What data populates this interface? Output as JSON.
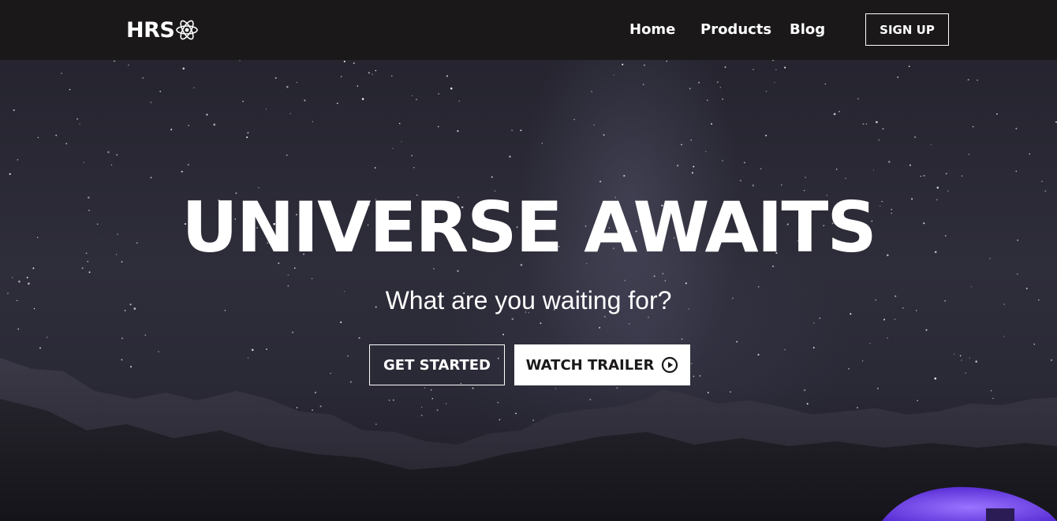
{
  "nav": {
    "logo_text": "HRS",
    "logo_icon": "atom-icon",
    "links": [
      "Home",
      "Products",
      "Blog"
    ],
    "signup_label": "SIGN UP"
  },
  "hero": {
    "title": "UNIVERSE AWAITS",
    "subtitle": "What are you waiting for?",
    "primary_button": "GET STARTED",
    "secondary_button": "WATCH TRAILER",
    "secondary_icon": "play-circle-icon"
  },
  "colors": {
    "navbar_bg": "#1a1818",
    "text": "#ffffff",
    "tent": "#7a4cff"
  }
}
